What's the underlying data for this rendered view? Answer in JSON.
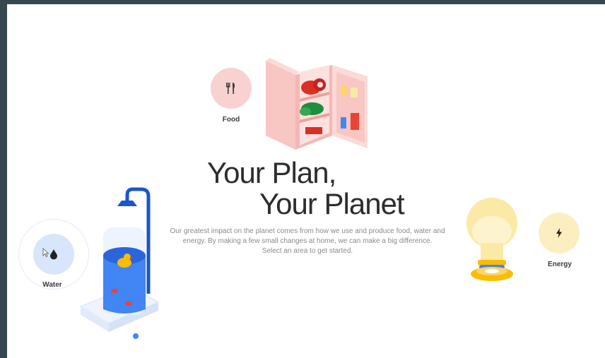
{
  "hero": {
    "title_line1": "Your Plan,",
    "title_line2": "Your Planet",
    "description_line1": "Our greatest impact on the planet comes from how we use and produce food, water and",
    "description_line2": "energy. By making a few small changes at home, we can make a big difference.",
    "description_line3": "Select an area to get started."
  },
  "categories": {
    "food": {
      "label": "Food",
      "icon": "fork-knife-icon",
      "color": "#f8d2d0"
    },
    "water": {
      "label": "Water",
      "icon": "water-drop-icon",
      "color": "#d8e6fb"
    },
    "energy": {
      "label": "Energy",
      "icon": "lightning-bolt-icon",
      "color": "#fdeec2"
    }
  },
  "colors": {
    "page_border": "#37474f",
    "title_text": "#2d2d2d",
    "body_text": "#8a8a8a",
    "water_blue": "#3b78e7",
    "fridge_pink": "#f4b8b4",
    "bulb_yellow": "#fbe9a6"
  }
}
